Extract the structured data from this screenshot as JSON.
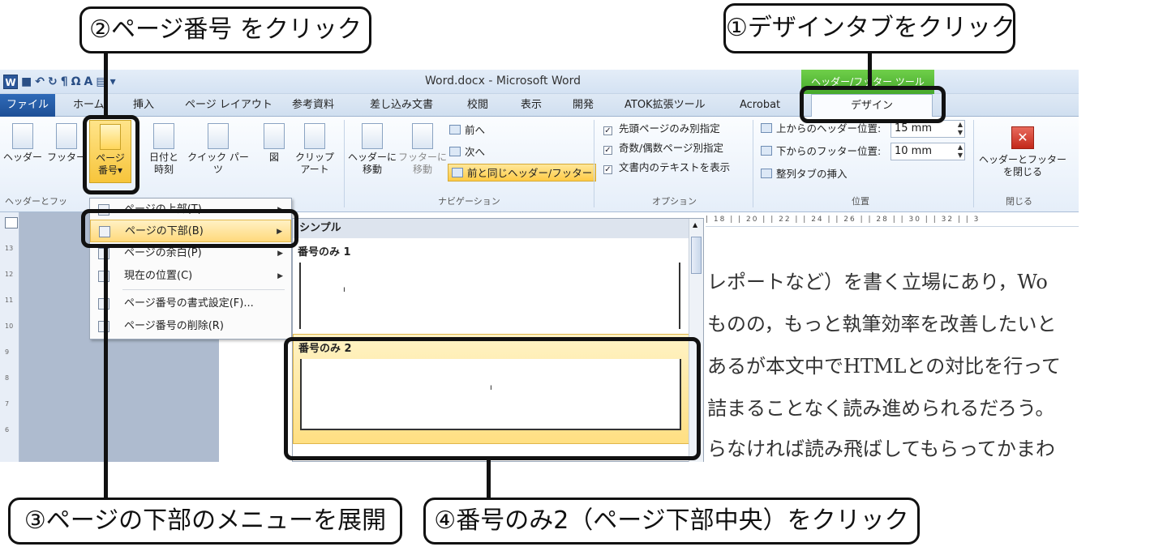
{
  "window": {
    "title": "Word.docx - Microsoft Word",
    "contextual_group": "ヘッダー/フッター ツール",
    "quick_access": [
      "W",
      "■",
      "↶",
      "↻",
      "¶",
      "Ω",
      "A",
      "▤",
      "▾"
    ]
  },
  "tabs": [
    {
      "label": "ファイル"
    },
    {
      "label": "ホーム"
    },
    {
      "label": "挿入"
    },
    {
      "label": "ページ レイアウト"
    },
    {
      "label": "参考資料"
    },
    {
      "label": "差し込み文書"
    },
    {
      "label": "校閲"
    },
    {
      "label": "表示"
    },
    {
      "label": "開発"
    },
    {
      "label": "ATOK拡張ツール"
    },
    {
      "label": "Acrobat"
    },
    {
      "label": "デザイン"
    }
  ],
  "ribbon": {
    "header_footer": {
      "header": "ヘッダー",
      "footer": "フッター",
      "page_number_line1": "ページ",
      "page_number_line2": "番号",
      "dropdown_arrow": "▾",
      "group_label": "ヘッダーとフッ"
    },
    "insert": {
      "datetime_line1": "日付と",
      "datetime_line2": "時刻",
      "quick_parts": "クイック パーツ",
      "picture": "図",
      "clipart_line1": "クリップ",
      "clipart_line2": "アート"
    },
    "navigation": {
      "goto_header_line1": "ヘッダーに",
      "goto_header_line2": "移動",
      "goto_footer_line1": "フッターに",
      "goto_footer_line2": "移動",
      "previous": "前へ",
      "next": "次へ",
      "link_previous": "前と同じヘッダー/フッター",
      "group_label": "ナビゲーション"
    },
    "options": {
      "different_first": "先頭ページのみ別指定",
      "different_odd_even": "奇数/偶数ページ別指定",
      "show_doc_text": "文書内のテキストを表示",
      "check_mark": "✓",
      "group_label": "オプション"
    },
    "position": {
      "header_from_top_label": "上からのヘッダー位置:",
      "header_from_top_value": "15 mm",
      "footer_from_bottom_label": "下からのフッター位置:",
      "footer_from_bottom_value": "10 mm",
      "insert_align_tab": "整列タブの挿入",
      "group_label": "位置"
    },
    "close": {
      "icon_glyph": "✕",
      "label_line1": "ヘッダーとフッター",
      "label_line2": "を閉じる",
      "group_label": "閉じる"
    }
  },
  "page_number_menu": {
    "items": [
      {
        "label": "ページの上部(T)"
      },
      {
        "label": "ページの下部(B)"
      },
      {
        "label": "ページの余白(P)"
      },
      {
        "label": "現在の位置(C)"
      },
      {
        "label": "ページ番号の書式設定(F)..."
      },
      {
        "label": "ページ番号の削除(R)"
      }
    ],
    "submenu_arrow": "▶"
  },
  "gallery": {
    "section_header": "シンプル",
    "items": [
      {
        "label": "番号のみ 1"
      },
      {
        "label": "番号のみ 2"
      }
    ]
  },
  "document": {
    "ruler_text": "| 18 |   | 20 |  | 22 |   | 24 |   | 26 |   | 28 |   | 30 |   | 32 |   | 3",
    "vruler_marks": [
      "13",
      "12",
      "11",
      "10",
      "9",
      "8",
      "7",
      "6"
    ],
    "lines": [
      "レポートなど）を書く立場にあり，Wo",
      "ものの，もっと執筆効率を改善したいと",
      "あるが本文中でHTMLとの対比を行って",
      "詰まることなく読み進められるだろう。",
      "らなければ読み飛ばしてもらってかまわ"
    ]
  },
  "annotations": {
    "step1": "①デザインタブをクリック",
    "step2": "②ページ番号 をクリック",
    "step3": "③ページの下部のメニューを展開",
    "step4": "④番号のみ2（ページ下部中央）をクリック"
  }
}
